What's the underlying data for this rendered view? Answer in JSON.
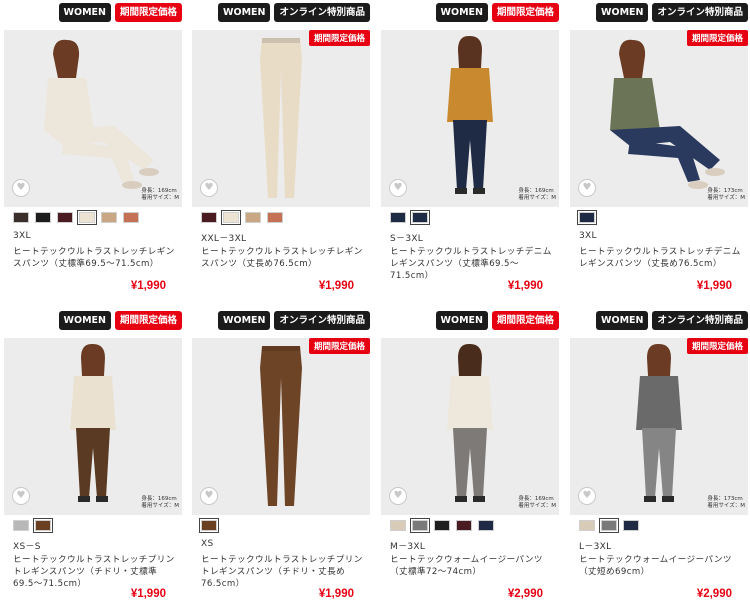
{
  "products": [
    {
      "badges": [
        {
          "label": "WOMEN",
          "style": "black"
        },
        {
          "label": "期間限定価格",
          "style": "red"
        }
      ],
      "image_tag": "",
      "model_note": [
        "身長：169cm",
        "着用サイズ：M"
      ],
      "colors": [
        "#3a2f2a",
        "#1e1e1e",
        "#4a1c22",
        "#ece3d3",
        "#c9a785",
        "#c47156"
      ],
      "selected_color": 3,
      "sizes": "3XL",
      "title": "ヒートテックウルトラストレッチレギンスパンツ（丈標準69.5〜71.5cm）",
      "price": "¥1,990",
      "photo": {
        "bg": "#ececec",
        "top": "#ece6db",
        "bottom": "#ece6db",
        "hair": "#6b3c23",
        "pose": "sitting"
      }
    },
    {
      "badges": [
        {
          "label": "WOMEN",
          "style": "black"
        },
        {
          "label": "オンライン特別商品",
          "style": "black"
        }
      ],
      "image_tag": "期間限定価格",
      "model_note": [],
      "colors": [
        "#4a1c22",
        "#ece3d3",
        "#c9a785",
        "#c47156"
      ],
      "selected_color": 1,
      "sizes": "XXL－3XL",
      "title": "ヒートテックウルトラストレッチレギンスパンツ（丈長め76.5cm）",
      "price": "¥1,990",
      "photo": {
        "bg": "#ececec",
        "top": "none",
        "bottom": "#e9dcc6",
        "hair": "none",
        "pose": "pants"
      }
    },
    {
      "badges": [
        {
          "label": "WOMEN",
          "style": "black"
        },
        {
          "label": "期間限定価格",
          "style": "red"
        }
      ],
      "image_tag": "",
      "model_note": [
        "身長：169cm",
        "着用サイズ：M"
      ],
      "colors": [
        "#1d2a44",
        "#1f2b45"
      ],
      "selected_color": 1,
      "sizes": "S－3XL",
      "title": "ヒートテックウルトラストレッチデニムレギンスパンツ（丈標準69.5〜71.5cm）",
      "price": "¥1,990",
      "photo": {
        "bg": "#ececec",
        "top": "#c9892f",
        "bottom": "#1f2a44",
        "hair": "#5a3320",
        "pose": "standing"
      }
    },
    {
      "badges": [
        {
          "label": "WOMEN",
          "style": "black"
        },
        {
          "label": "オンライン特別商品",
          "style": "black"
        }
      ],
      "image_tag": "期間限定価格",
      "model_note": [
        "身長：173cm",
        "着用サイズ：M"
      ],
      "colors": [
        "#1f2b45"
      ],
      "selected_color": 0,
      "sizes": "3XL",
      "title": "ヒートテックウルトラストレッチデニムレギンスパンツ（丈長め76.5cm）",
      "price": "¥1,990",
      "photo": {
        "bg": "#ececec",
        "top": "#6b7457",
        "bottom": "#2a3a5e",
        "hair": "#6b3c23",
        "pose": "sitting"
      }
    },
    {
      "badges": [
        {
          "label": "WOMEN",
          "style": "black"
        },
        {
          "label": "期間限定価格",
          "style": "red"
        }
      ],
      "image_tag": "",
      "model_note": [
        "身長：169cm",
        "着用サイズ：M"
      ],
      "colors": [
        "#b8b8b8",
        "#6b3f22"
      ],
      "selected_color": 1,
      "sizes": "XS－S",
      "title": "ヒートテックウルトラストレッチプリントレギンスパンツ（チドリ・丈標準69.5〜71.5cm）",
      "price": "¥1,990",
      "photo": {
        "bg": "#ececec",
        "top": "#ebe1d1",
        "bottom": "#5a3a22",
        "hair": "#6b3c23",
        "pose": "standing"
      }
    },
    {
      "badges": [
        {
          "label": "WOMEN",
          "style": "black"
        },
        {
          "label": "オンライン特別商品",
          "style": "black"
        }
      ],
      "image_tag": "期間限定価格",
      "model_note": [],
      "colors": [
        "#6b3f22"
      ],
      "selected_color": 0,
      "sizes": "XS",
      "title": "ヒートテックウルトラストレッチプリントレギンスパンツ（チドリ・丈長め76.5cm）",
      "price": "¥1,990",
      "photo": {
        "bg": "#ececec",
        "top": "none",
        "bottom": "#6e4427",
        "hair": "none",
        "pose": "pants"
      }
    },
    {
      "badges": [
        {
          "label": "WOMEN",
          "style": "black"
        },
        {
          "label": "期間限定価格",
          "style": "red"
        }
      ],
      "image_tag": "",
      "model_note": [
        "身長：169cm",
        "着用サイズ：M"
      ],
      "colors": [
        "#d8cbb8",
        "#7a7a7a",
        "#1e1e1e",
        "#4a1c22",
        "#1f2b45"
      ],
      "selected_color": 1,
      "sizes": "M－3XL",
      "title": "ヒートテックウォームイージーパンツ（丈標準72〜74cm）",
      "price": "¥2,990",
      "photo": {
        "bg": "#ececec",
        "top": "#ede7dc",
        "bottom": "#7d7a78",
        "hair": "#4a2c1c",
        "pose": "standing"
      }
    },
    {
      "badges": [
        {
          "label": "WOMEN",
          "style": "black"
        },
        {
          "label": "オンライン特別商品",
          "style": "black"
        }
      ],
      "image_tag": "期間限定価格",
      "model_note": [
        "身長：173cm",
        "着用サイズ：M"
      ],
      "colors": [
        "#d8cbb8",
        "#7a7a7a",
        "#1f2b45"
      ],
      "selected_color": 1,
      "sizes": "L－3XL",
      "title": "ヒートテックウォームイージーパンツ（丈短め69cm）",
      "price": "¥2,990",
      "photo": {
        "bg": "#ececec",
        "top": "#6a6a6a",
        "bottom": "#858585",
        "hair": "#6b3c23",
        "pose": "standing"
      }
    }
  ]
}
